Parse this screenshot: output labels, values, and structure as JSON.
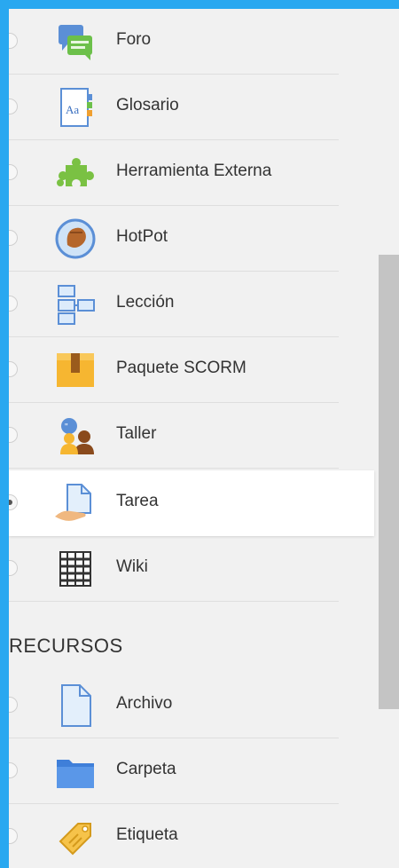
{
  "activities": [
    {
      "label": "Foro",
      "icon": "forum-icon",
      "selected": false
    },
    {
      "label": "Glosario",
      "icon": "glossary-icon",
      "selected": false
    },
    {
      "label": "Herramienta Externa",
      "icon": "puzzle-piece-icon",
      "selected": false
    },
    {
      "label": "HotPot",
      "icon": "hotpot-icon",
      "selected": false
    },
    {
      "label": "Lección",
      "icon": "lesson-icon",
      "selected": false
    },
    {
      "label": "Paquete SCORM",
      "icon": "scorm-package-icon",
      "selected": false
    },
    {
      "label": "Taller",
      "icon": "workshop-icon",
      "selected": false
    },
    {
      "label": "Tarea",
      "icon": "assignment-icon",
      "selected": true
    },
    {
      "label": "Wiki",
      "icon": "wiki-icon",
      "selected": false
    }
  ],
  "resources_heading": "RECURSOS",
  "resources": [
    {
      "label": "Archivo",
      "icon": "file-icon",
      "selected": false
    },
    {
      "label": "Carpeta",
      "icon": "folder-icon",
      "selected": false
    },
    {
      "label": "Etiqueta",
      "icon": "label-tag-icon",
      "selected": false
    }
  ],
  "colors": {
    "background_accent": "#29a8f0",
    "panel": "#f1f1f1",
    "selected_row": "#ffffff"
  }
}
